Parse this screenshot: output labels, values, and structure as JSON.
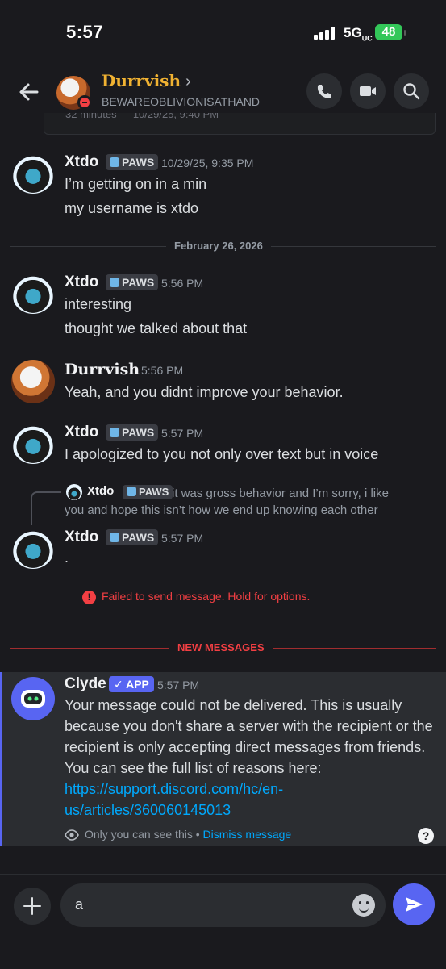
{
  "status_bar": {
    "time": "5:57",
    "network": "5G",
    "network_sub": "UC",
    "battery": "48"
  },
  "header": {
    "name": "Durrvish",
    "chevron": "›",
    "username": "BEWAREOBLIVIONISATHAND"
  },
  "previous_embed": {
    "text": "32 minutes — 10/29/25, 9:40 PM"
  },
  "messages": [
    {
      "author": "Xtdo",
      "tag": "PAWS",
      "time": "10/29/25, 9:35 PM",
      "lines": [
        "I’m getting on in a min",
        "my username is xtdo"
      ]
    },
    {
      "author": "Xtdo",
      "tag": "PAWS",
      "time": "5:56 PM",
      "lines": [
        "interesting",
        "thought we talked about that"
      ]
    },
    {
      "author": "Durrvish",
      "time": "5:56 PM",
      "lines": [
        "Yeah, and you didnt improve your behavior."
      ]
    },
    {
      "author": "Xtdo",
      "tag": "PAWS",
      "time": "5:57 PM",
      "lines": [
        "I apologized to you not only over text but in voice"
      ]
    },
    {
      "author": "Xtdo",
      "tag": "PAWS",
      "time": "5:57 PM",
      "lines": [
        "."
      ]
    }
  ],
  "date_divider": "February 26, 2026",
  "reply": {
    "author": "Xtdo",
    "tag": "PAWS",
    "text": "it was gross behavior and I’m sorry, i like",
    "text2": "you and hope this isn’t how we end up knowing each other"
  },
  "failed_notice": "Failed to send message. Hold for options.",
  "new_messages_label": "NEW MESSAGES",
  "clyde": {
    "author": "Clyde",
    "badge": "✓ APP",
    "time": "5:57 PM",
    "text": "Your message could not be delivered. This is usually because you don't share a server with the recipient or the recipient is only accepting direct messages from friends. You can see the full list of reasons here: ",
    "link": "https://support.discord.com/hc/en-us/articles/360060145013",
    "ephemeral": "Only you can see this •",
    "dismiss": "Dismiss message",
    "help": "?"
  },
  "composer": {
    "value": "a"
  },
  "colors": {
    "accent": "#5865f2",
    "danger": "#f23f43",
    "link": "#00a8fc",
    "name_gold": "#f0b232"
  }
}
